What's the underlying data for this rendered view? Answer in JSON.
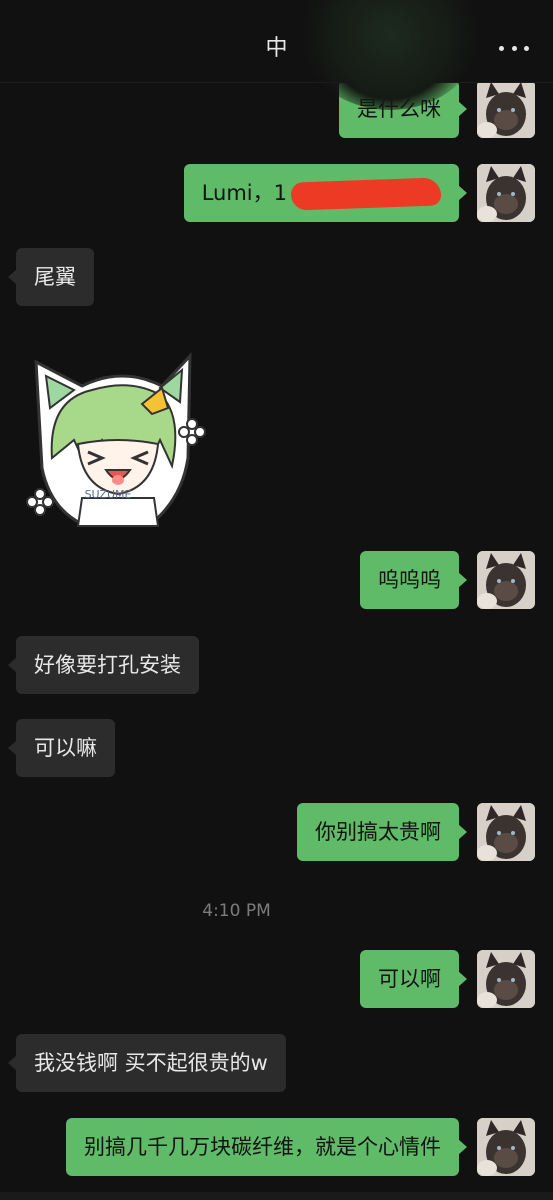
{
  "header": {
    "title": "中"
  },
  "messages": {
    "m1": "是什么咪",
    "m2": "Lumi，1",
    "m3": "尾翼",
    "m4": "呜呜呜",
    "m5": "好像要打孔安装",
    "m6": "可以嘛",
    "m7": "你别搞太贵啊",
    "time": "4:10 PM",
    "m8": "可以啊",
    "m9": "我没钱啊 买不起很贵的w",
    "m10": "别搞几千几万块碳纤维，就是个心情件"
  },
  "sticker": {
    "text": "SUZUME",
    "icon": "anime-girl-sticker"
  },
  "colors": {
    "background": "#111111",
    "outgoing_bubble": "#5fbb67",
    "incoming_bubble": "#2c2c2c",
    "redaction": "#ec3a24"
  }
}
